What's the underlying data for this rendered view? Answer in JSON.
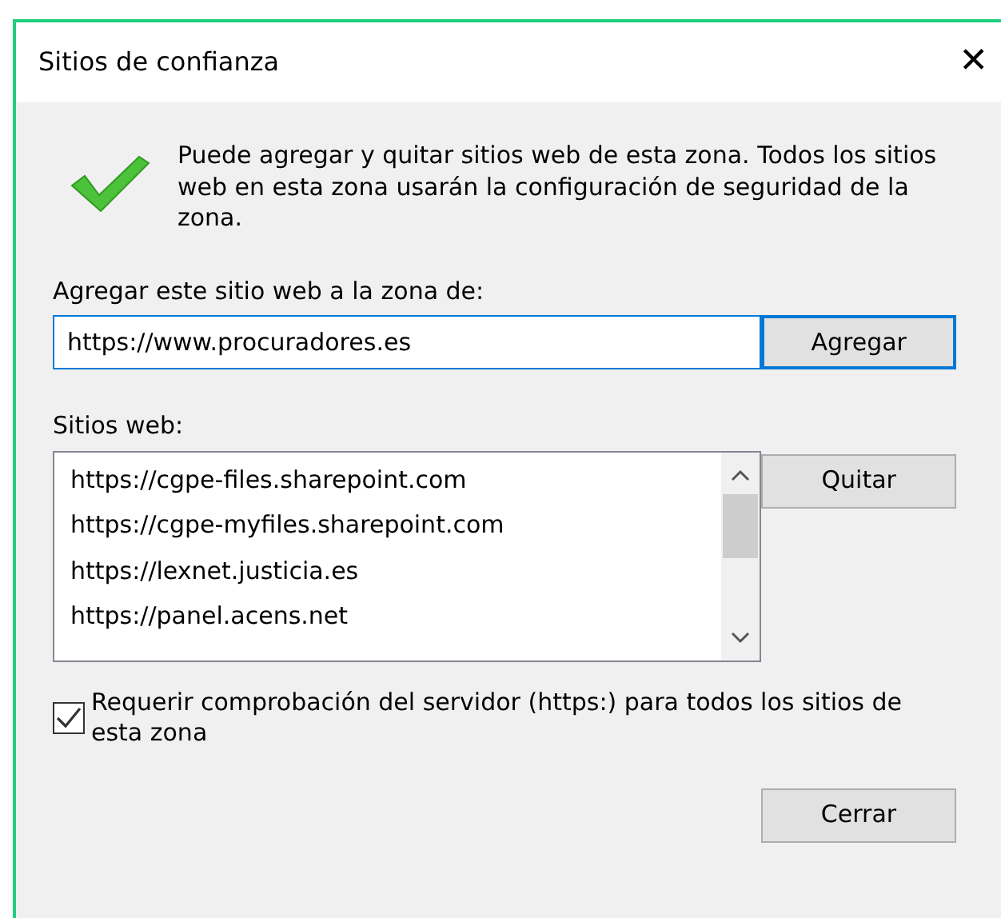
{
  "window": {
    "title": "Sitios de confianza",
    "close": "✕"
  },
  "message": "Puede agregar y quitar sitios web de esta zona. Todos los sitios web en esta zona usarán la configuración de seguridad de la zona.",
  "add_field": {
    "label": "Agregar este sitio web a la zona de:",
    "value": "https://www.procuradores.es"
  },
  "add_button": "Agregar",
  "sites": {
    "label": "Sitios web:",
    "items": [
      "https://cgpe-files.sharepoint.com",
      "https://cgpe-myfiles.sharepoint.com",
      "https://lexnet.justicia.es",
      "https://panel.acens.net"
    ]
  },
  "remove_button": "Quitar",
  "require_https": {
    "label": "Requerir comprobación del servidor (https:) para todos los sitios de esta zona",
    "checked": true
  },
  "close_button": "Cerrar"
}
